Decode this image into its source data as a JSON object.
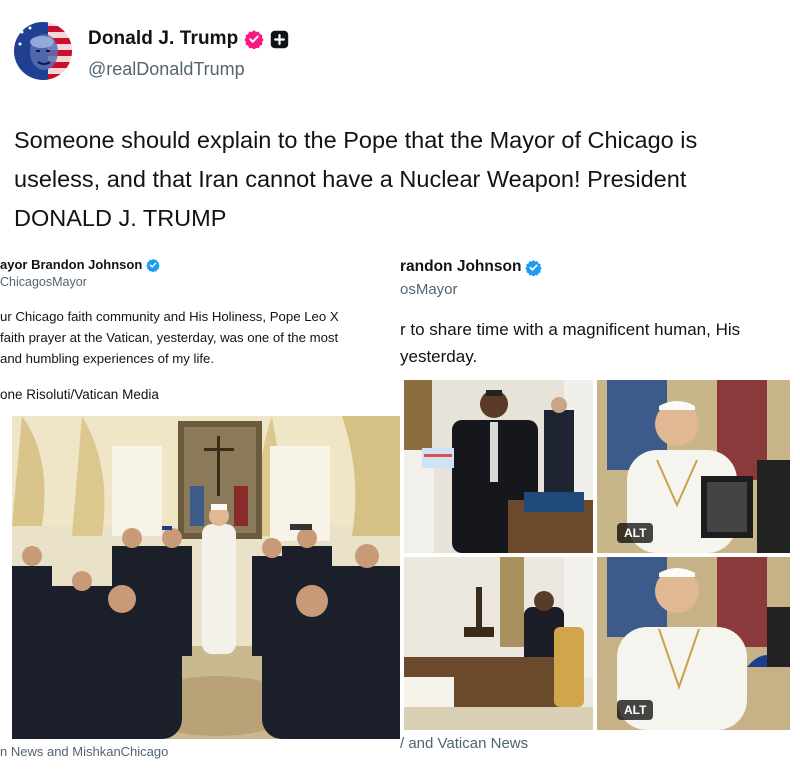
{
  "post": {
    "author_name": "Donald J. Trump",
    "author_handle": "@realDonaldTrump",
    "text_lines": [
      "Someone should explain to the Pope that the Mayor of Chicago is",
      "useless, and that Iran cannot have a Nuclear Weapon! President",
      "DONALD J. TRUMP"
    ]
  },
  "left_screenshot": {
    "name": "ayor Brandon Johnson",
    "handle": "ChicagosMayor",
    "body_lines": [
      "ur Chicago faith community and His Holiness, Pope Leo X",
      "faith prayer at the Vatican, yesterday, was one of the most",
      "and humbling experiences of my life."
    ],
    "photo_credit": "one Risoluti/Vatican Media",
    "source_note": "n News and MishkanChicago"
  },
  "right_screenshot": {
    "name": "randon Johnson",
    "handle": "osMayor",
    "body_lines": [
      "r to share time with a magnificent human, His",
      "yesterday."
    ],
    "alt_badges": [
      "ALT",
      "ALT"
    ],
    "source_note": "/ and Vatican News"
  },
  "colors": {
    "verified_badge": "#f91880",
    "blue_check": "#1d9bf0",
    "text": "#0f1419",
    "secondary_text": "#536471"
  },
  "icons": {
    "verified": "verified-badge-icon",
    "subscription": "plus-badge-icon",
    "blue_check": "blue-check-icon"
  }
}
